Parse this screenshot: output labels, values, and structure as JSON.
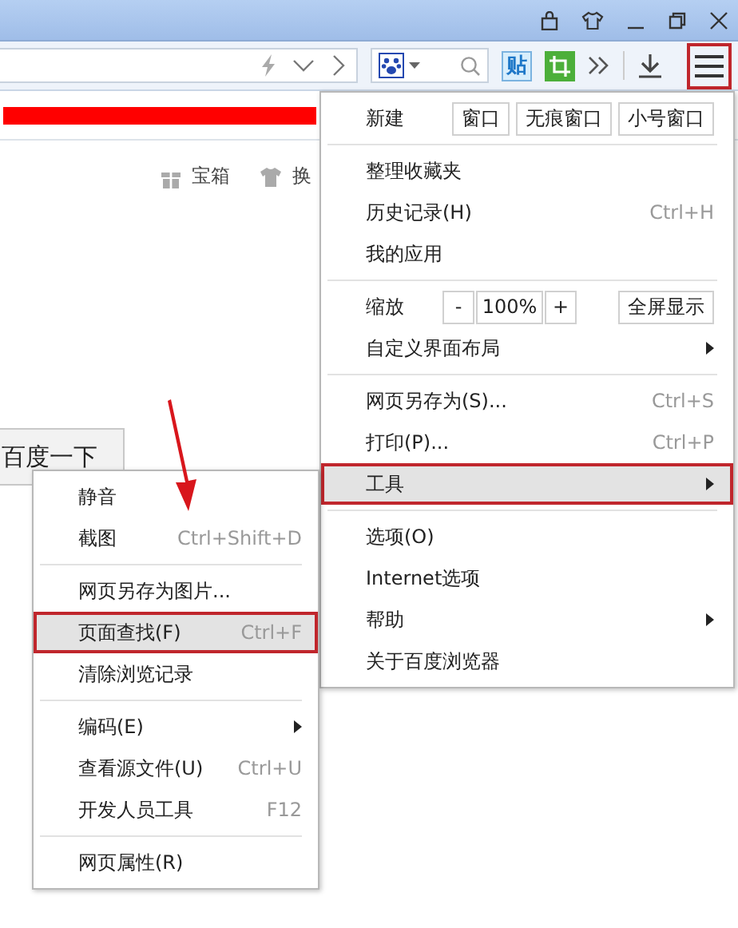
{
  "toolbar": {
    "paste_badge": "贴",
    "menu_button": {
      "annotated": true
    }
  },
  "page": {
    "shortcuts": [
      {
        "kind": "gift",
        "label": "宝箱"
      },
      {
        "kind": "shirt",
        "label": "换"
      }
    ],
    "search_button": "百度一下"
  },
  "main_menu": {
    "sections": [
      {
        "items": [
          {
            "kind": "new",
            "label": "新建",
            "buttons": [
              "窗口",
              "无痕窗口",
              "小号窗口"
            ]
          }
        ]
      },
      {
        "items": [
          {
            "kind": "item",
            "label": "整理收藏夹",
            "selected": false,
            "annotated": false,
            "submenu": false
          },
          {
            "kind": "item",
            "label": "历史记录(H)",
            "shortcut": "Ctrl+H",
            "selected": false,
            "annotated": false,
            "submenu": false
          },
          {
            "kind": "item",
            "label": "我的应用",
            "selected": false,
            "annotated": false,
            "submenu": false
          }
        ]
      },
      {
        "items": [
          {
            "kind": "zoom",
            "label": "缩放",
            "minus": "-",
            "value": "100%",
            "plus": "+",
            "fullscreen": "全屏显示"
          },
          {
            "kind": "item",
            "label": "自定义界面布局",
            "selected": false,
            "annotated": false,
            "submenu": true
          }
        ]
      },
      {
        "items": [
          {
            "kind": "item",
            "label": "网页另存为(S)...",
            "shortcut": "Ctrl+S",
            "selected": false,
            "annotated": false,
            "submenu": false
          },
          {
            "kind": "item",
            "label": "打印(P)...",
            "shortcut": "Ctrl+P",
            "selected": false,
            "annotated": false,
            "submenu": false
          },
          {
            "kind": "item",
            "label": "工具",
            "selected": true,
            "annotated": true,
            "submenu": true
          }
        ]
      },
      {
        "items": [
          {
            "kind": "item",
            "label": "选项(O)",
            "selected": false,
            "annotated": false,
            "submenu": false
          },
          {
            "kind": "item",
            "label": "Internet选项",
            "selected": false,
            "annotated": false,
            "submenu": false
          },
          {
            "kind": "item",
            "label": "帮助",
            "selected": false,
            "annotated": false,
            "submenu": true
          },
          {
            "kind": "item",
            "label": "关于百度浏览器",
            "selected": false,
            "annotated": false,
            "submenu": false
          }
        ]
      }
    ]
  },
  "tools_submenu": {
    "sections": [
      {
        "items": [
          {
            "label": "静音",
            "selected": false,
            "annotated": false,
            "submenu": false
          },
          {
            "label": "截图",
            "shortcut": "Ctrl+Shift+D",
            "selected": false,
            "annotated": false,
            "submenu": false
          }
        ]
      },
      {
        "items": [
          {
            "label": "网页另存为图片...",
            "selected": false,
            "annotated": false,
            "submenu": false
          },
          {
            "label": "页面查找(F)",
            "shortcut": "Ctrl+F",
            "selected": true,
            "annotated": true,
            "submenu": false
          },
          {
            "label": "清除浏览记录",
            "selected": false,
            "annotated": false,
            "submenu": false
          }
        ]
      },
      {
        "items": [
          {
            "label": "编码(E)",
            "selected": false,
            "annotated": false,
            "submenu": true
          },
          {
            "label": "查看源文件(U)",
            "shortcut": "Ctrl+U",
            "selected": false,
            "annotated": false,
            "submenu": false
          },
          {
            "label": "开发人员工具",
            "shortcut": "F12",
            "selected": false,
            "annotated": false,
            "submenu": false
          }
        ]
      },
      {
        "items": [
          {
            "label": "网页属性(R)",
            "selected": false,
            "annotated": false,
            "submenu": false
          }
        ]
      }
    ]
  }
}
